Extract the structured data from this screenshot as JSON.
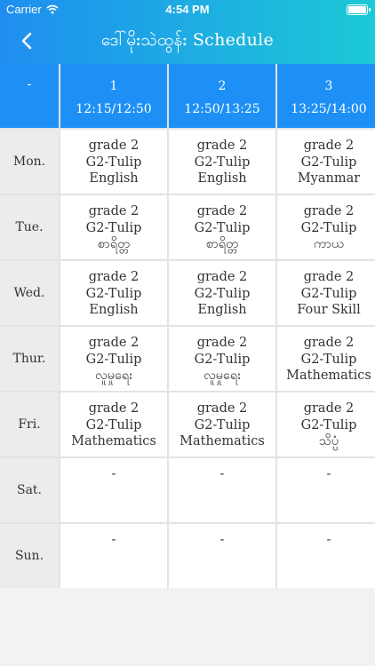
{
  "status_bar": {
    "carrier": "Carrier",
    "time": "4:54 PM"
  },
  "nav": {
    "title": "ဒေါ်မိုးသဲထွန်း Schedule"
  },
  "header_row": {
    "corner": "-",
    "periods": [
      {
        "number": "1",
        "time": "12:15/12:50"
      },
      {
        "number": "2",
        "time": "12:50/13:25"
      },
      {
        "number": "3",
        "time": "13:25/14:00"
      }
    ]
  },
  "days": [
    {
      "name": "Mon.",
      "cells": [
        {
          "grade": "grade 2",
          "section": "G2-Tulip",
          "subject": "English"
        },
        {
          "grade": "grade 2",
          "section": "G2-Tulip",
          "subject": "English"
        },
        {
          "grade": "grade 2",
          "section": "G2-Tulip",
          "subject": "Myanmar"
        }
      ]
    },
    {
      "name": "Tue.",
      "cells": [
        {
          "grade": "grade 2",
          "section": "G2-Tulip",
          "subject": "စာရိတ္တ"
        },
        {
          "grade": "grade 2",
          "section": "G2-Tulip",
          "subject": "စာရိတ္တ"
        },
        {
          "grade": "grade 2",
          "section": "G2-Tulip",
          "subject": "ကာယ"
        }
      ]
    },
    {
      "name": "Wed.",
      "cells": [
        {
          "grade": "grade 2",
          "section": "G2-Tulip",
          "subject": "English"
        },
        {
          "grade": "grade 2",
          "section": "G2-Tulip",
          "subject": "English"
        },
        {
          "grade": "grade 2",
          "section": "G2-Tulip",
          "subject": "Four Skill"
        }
      ]
    },
    {
      "name": "Thur.",
      "cells": [
        {
          "grade": "grade 2",
          "section": "G2-Tulip",
          "subject": "လူမှုရေး"
        },
        {
          "grade": "grade 2",
          "section": "G2-Tulip",
          "subject": "လူမှုရေး"
        },
        {
          "grade": "grade 2",
          "section": "G2-Tulip",
          "subject": "Mathematics"
        }
      ]
    },
    {
      "name": "Fri.",
      "cells": [
        {
          "grade": "grade 2",
          "section": "G2-Tulip",
          "subject": "Mathematics"
        },
        {
          "grade": "grade 2",
          "section": "G2-Tulip",
          "subject": "Mathematics"
        },
        {
          "grade": "grade 2",
          "section": "G2-Tulip",
          "subject": "သိပ္ပံ"
        }
      ]
    },
    {
      "name": "Sat.",
      "cells": [
        {
          "grade": "-",
          "section": "",
          "subject": ""
        },
        {
          "grade": "-",
          "section": "",
          "subject": ""
        },
        {
          "grade": "-",
          "section": "",
          "subject": ""
        }
      ]
    },
    {
      "name": "Sun.",
      "cells": [
        {
          "grade": "-",
          "section": "",
          "subject": ""
        },
        {
          "grade": "-",
          "section": "",
          "subject": ""
        },
        {
          "grade": "-",
          "section": "",
          "subject": ""
        }
      ]
    }
  ],
  "colors": {
    "header_start": "#1f8ef0",
    "header_end": "#1cc9d6",
    "period_header": "#1e90f5"
  },
  "icons": {
    "back": "chevron-left-icon",
    "wifi": "wifi-icon",
    "battery": "battery-icon"
  }
}
